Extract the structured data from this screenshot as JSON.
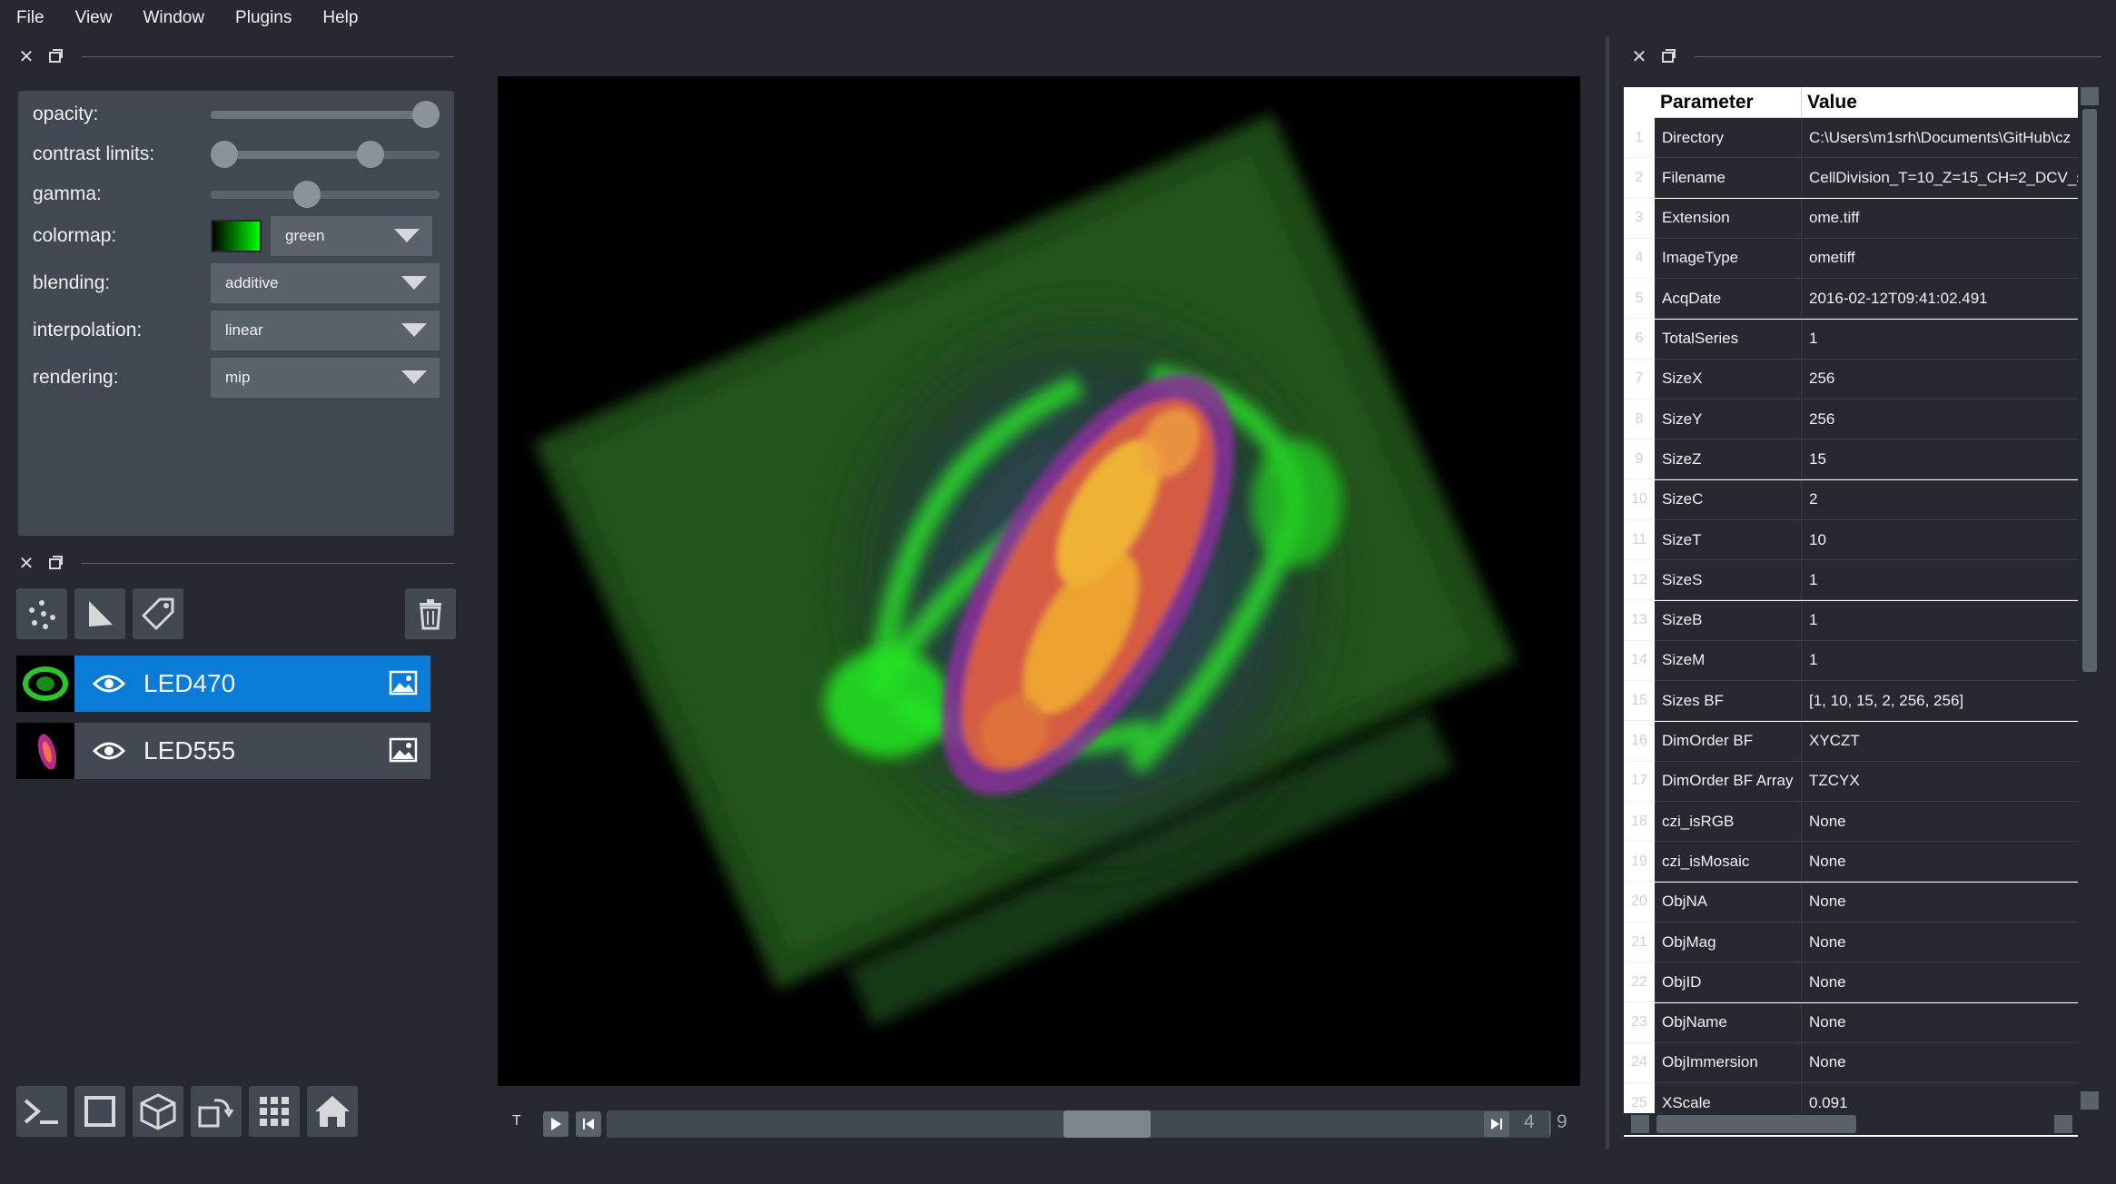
{
  "menu": [
    "File",
    "View",
    "Window",
    "Plugins",
    "Help"
  ],
  "layer_controls": {
    "opacity_label": "opacity:",
    "contrast_label": "contrast limits:",
    "gamma_label": "gamma:",
    "colormap_label": "colormap:",
    "colormap_value": "green",
    "blending_label": "blending:",
    "blending_value": "additive",
    "interpolation_label": "interpolation:",
    "interpolation_value": "linear",
    "rendering_label": "rendering:",
    "rendering_value": "mip",
    "opacity_level": 1.0,
    "contrast_low_level": 0.0,
    "contrast_high_level": 0.7,
    "gamma_level": 0.42
  },
  "layers": [
    {
      "name": "LED470",
      "selected": true,
      "thumb_color": "#1aa31a"
    },
    {
      "name": "LED555",
      "selected": false,
      "thumb_color": "#c03080"
    }
  ],
  "dims": {
    "axis_label": "T",
    "current": "4",
    "max": "9",
    "position_fraction": 0.44
  },
  "colors": {
    "selected_layer": "#0a7bd6",
    "unselected_layer": "#414851",
    "background": "#262930"
  },
  "table": {
    "header_param": "Parameter",
    "header_value": "Value",
    "rows": [
      {
        "num": "1",
        "param": "Directory",
        "value": "C:\\Users\\m1srh\\Documents\\GitHub\\cz"
      },
      {
        "num": "2",
        "param": "Filename",
        "value": "CellDivision_T=10_Z=15_CH=2_DCV_s"
      },
      {
        "num": "3",
        "param": "Extension",
        "value": "ome.tiff"
      },
      {
        "num": "4",
        "param": "ImageType",
        "value": "ometiff"
      },
      {
        "num": "5",
        "param": "AcqDate",
        "value": "2016-02-12T09:41:02.491"
      },
      {
        "num": "6",
        "param": "TotalSeries",
        "value": "1"
      },
      {
        "num": "7",
        "param": "SizeX",
        "value": "256"
      },
      {
        "num": "8",
        "param": "SizeY",
        "value": "256"
      },
      {
        "num": "9",
        "param": "SizeZ",
        "value": "15"
      },
      {
        "num": "10",
        "param": "SizeC",
        "value": "2"
      },
      {
        "num": "11",
        "param": "SizeT",
        "value": "10"
      },
      {
        "num": "12",
        "param": "SizeS",
        "value": "1"
      },
      {
        "num": "13",
        "param": "SizeB",
        "value": "1"
      },
      {
        "num": "14",
        "param": "SizeM",
        "value": "1"
      },
      {
        "num": "15",
        "param": "Sizes BF",
        "value": "[1, 10, 15, 2, 256, 256]"
      },
      {
        "num": "16",
        "param": "DimOrder BF",
        "value": "XYCZT"
      },
      {
        "num": "17",
        "param": "DimOrder BF Array",
        "value": "TZCYX"
      },
      {
        "num": "18",
        "param": "czi_isRGB",
        "value": "None"
      },
      {
        "num": "19",
        "param": "czi_isMosaic",
        "value": "None"
      },
      {
        "num": "20",
        "param": "ObjNA",
        "value": "None"
      },
      {
        "num": "21",
        "param": "ObjMag",
        "value": "None"
      },
      {
        "num": "22",
        "param": "ObjID",
        "value": "None"
      },
      {
        "num": "23",
        "param": "ObjName",
        "value": "None"
      },
      {
        "num": "24",
        "param": "ObjImmersion",
        "value": "None"
      },
      {
        "num": "25",
        "param": "XScale",
        "value": "0.091"
      }
    ]
  }
}
